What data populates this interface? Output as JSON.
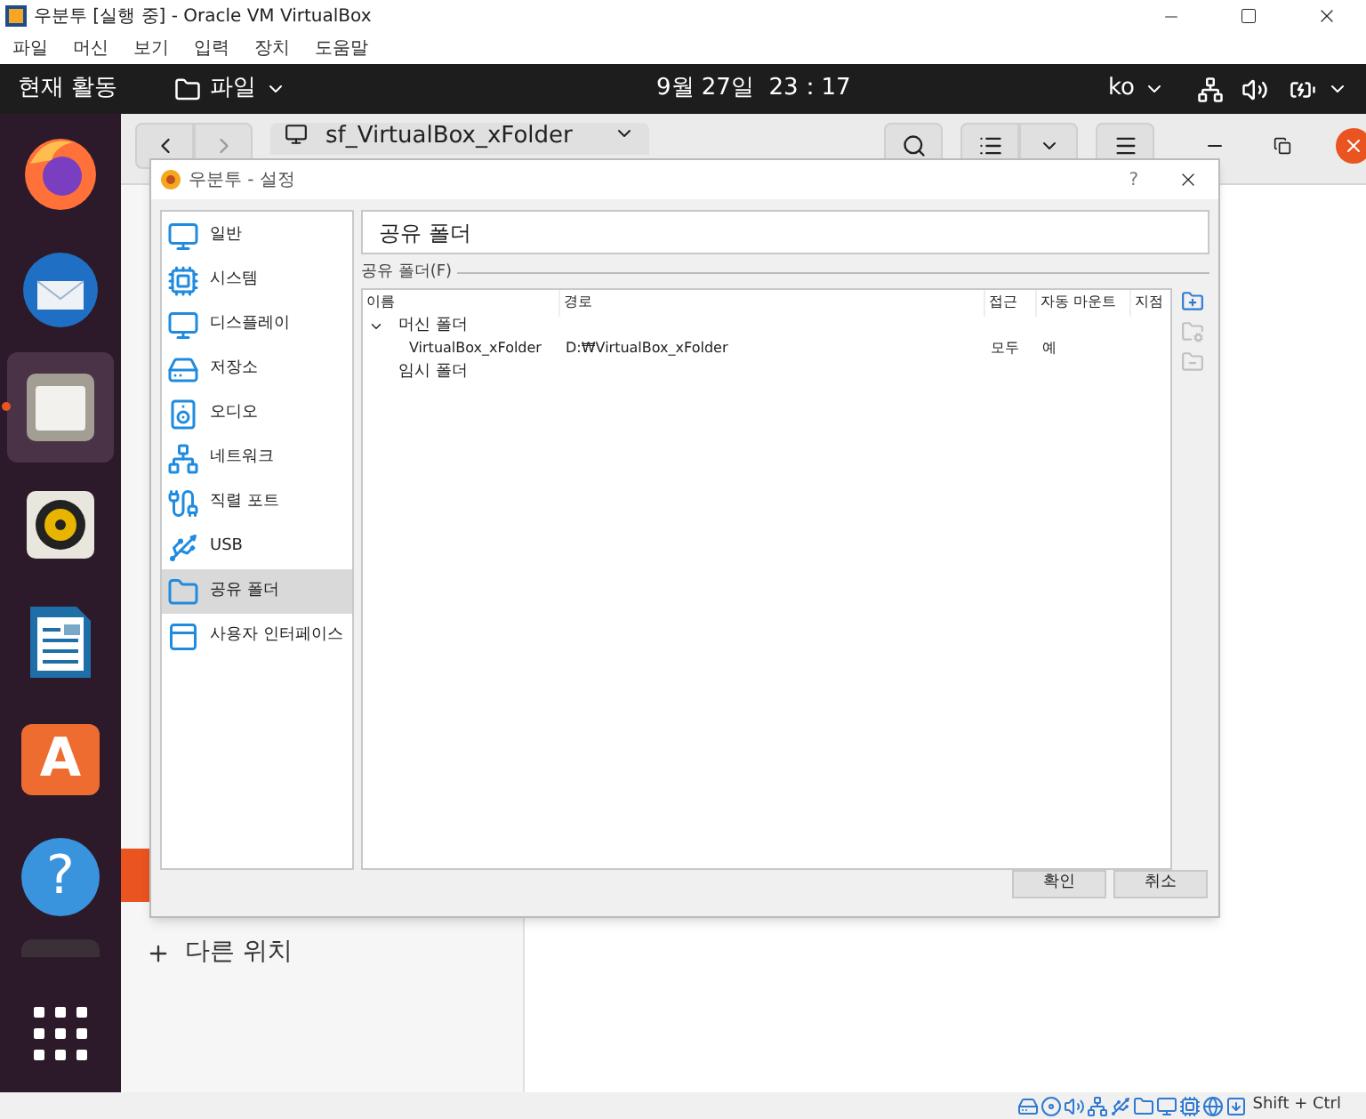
{
  "host_window": {
    "title": "우분투 [실행 중] - Oracle VM VirtualBox",
    "menu": [
      "파일",
      "머신",
      "보기",
      "입력",
      "장치",
      "도움말"
    ],
    "status_bar": {
      "host_key": "Shift + Ctrl"
    }
  },
  "top_bar": {
    "activities": "현재 활동",
    "app_menu": "파일",
    "clock": "9월 27일  23：17",
    "input_source": "ko"
  },
  "dock": [
    {
      "kind": "firefox",
      "selected": false
    },
    {
      "kind": "thunderbird",
      "selected": false
    },
    {
      "kind": "files",
      "selected": true
    },
    {
      "kind": "rhythmbox",
      "selected": false
    },
    {
      "kind": "writer",
      "selected": false
    },
    {
      "kind": "software",
      "selected": false,
      "glyph": "A"
    },
    {
      "kind": "help",
      "selected": false,
      "glyph": "?"
    },
    {
      "kind": "partial",
      "selected": false
    },
    {
      "kind": "apps",
      "selected": false
    }
  ],
  "files_window": {
    "path": "sf_VirtualBox_xFolder",
    "sidebar_items": [
      {
        "label": "다른 위치"
      }
    ]
  },
  "dialog": {
    "title": "우분투 - 설정",
    "help": "?",
    "categories": [
      {
        "kind": "general",
        "label": "일반",
        "selected": false
      },
      {
        "kind": "system",
        "label": "시스템",
        "selected": false
      },
      {
        "kind": "display",
        "label": "디스플레이",
        "selected": false
      },
      {
        "kind": "storage",
        "label": "저장소",
        "selected": false
      },
      {
        "kind": "audio",
        "label": "오디오",
        "selected": false
      },
      {
        "kind": "network",
        "label": "네트워크",
        "selected": false
      },
      {
        "kind": "serial",
        "label": "직렬 포트",
        "selected": false
      },
      {
        "kind": "usb",
        "label": "USB",
        "selected": false
      },
      {
        "kind": "shared",
        "label": "공유 폴더",
        "selected": true
      },
      {
        "kind": "ui",
        "label": "사용자 인터페이스",
        "selected": false
      }
    ],
    "page_title": "공유 폴더",
    "group_label": "공유 폴더(F)",
    "columns": [
      "이름",
      "경로",
      "접근",
      "자동 마운트",
      "지점"
    ],
    "folders": [
      {
        "name": "머신 폴더",
        "expanded": true,
        "children": [
          {
            "name": "VirtualBox_xFolder",
            "path": "D:₩VirtualBox_xFolder",
            "access": "모두",
            "automount": "예"
          }
        ]
      },
      {
        "name": "임시 폴더"
      }
    ],
    "buttons": [
      "확인",
      "취소"
    ]
  }
}
